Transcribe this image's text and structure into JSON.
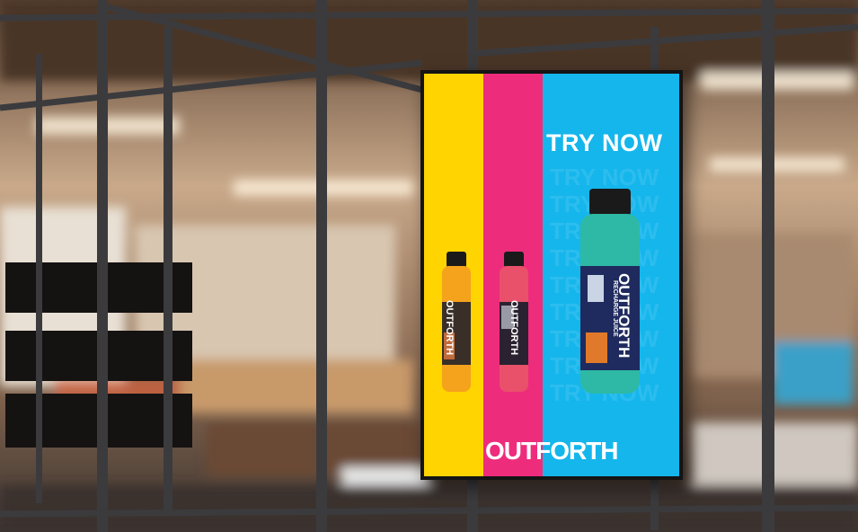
{
  "ad": {
    "headline": "TRY NOW",
    "brand": "OUTFORTH",
    "bottles": [
      {
        "brand": "OUTFORTH",
        "subtitle": "",
        "liquid": "#f5a21c",
        "label": "#3a2f28"
      },
      {
        "brand": "OUTFORTH",
        "subtitle": "",
        "liquid": "#e9506a",
        "label": "#2a2230"
      },
      {
        "brand": "OUTFORTH",
        "subtitle": "RECHARGE JUICE",
        "liquid": "#2db9a5",
        "label": "#1f2b5e"
      }
    ]
  },
  "colors": {
    "stripe_yellow": "#ffd400",
    "stripe_magenta": "#ee2c7c",
    "stripe_cyan": "#15b6ec",
    "frame": "#3a3a3a"
  }
}
